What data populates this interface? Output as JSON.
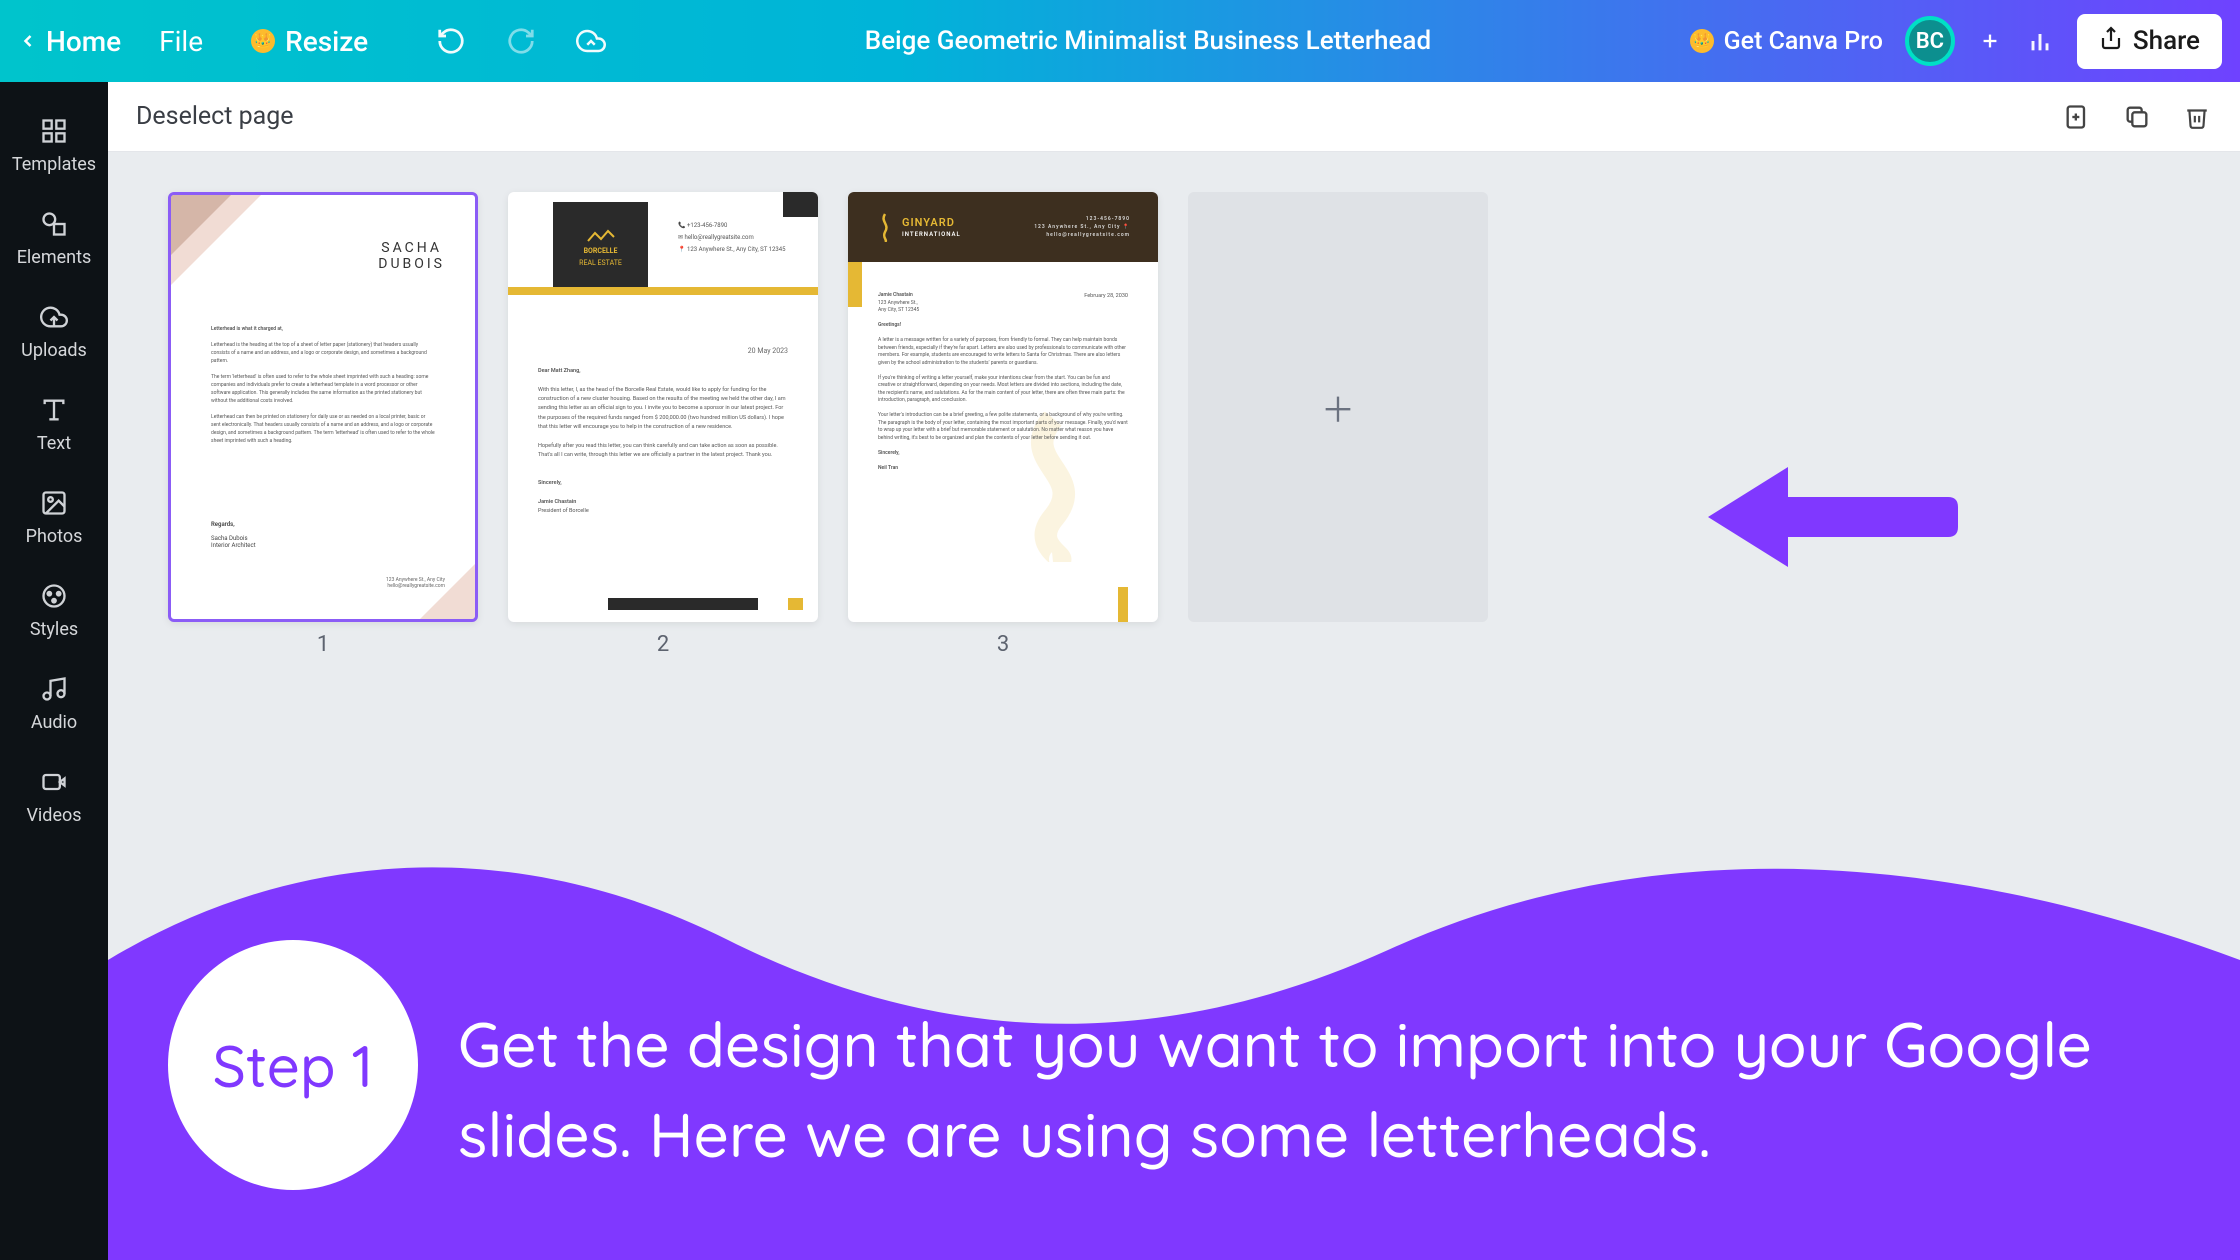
{
  "topbar": {
    "home": "Home",
    "file": "File",
    "resize": "Resize",
    "title": "Beige Geometric Minimalist Business Letterhead",
    "pro": "Get Canva Pro",
    "avatar": "BC",
    "share": "Share"
  },
  "sidebar": {
    "items": [
      {
        "label": "Templates"
      },
      {
        "label": "Elements"
      },
      {
        "label": "Uploads"
      },
      {
        "label": "Text"
      },
      {
        "label": "Photos"
      },
      {
        "label": "Styles"
      },
      {
        "label": "Audio"
      },
      {
        "label": "Videos"
      }
    ]
  },
  "subbar": {
    "deselect": "Deselect page"
  },
  "pages": {
    "p1": "1",
    "p2": "2",
    "p3": "3"
  },
  "thumb1": {
    "name1": "SACHA",
    "name2": "DUBOIS",
    "b1": "Letterhead is what it charged at,",
    "b2": "Letterhead is the heading at the top of a sheet of letter paper (stationery) that headers usually consists of a name and an address, and a logo or corporate design, and sometimes a background pattern.",
    "b3": "The term 'letterhead' is often used to refer to the whole sheet imprinted with such a heading: some companies and individuals prefer to create a letterhead template in a word processor or other software application. This generally includes the same information as the printed stationery but without the additional costs involved.",
    "b4": "Letterhead can then be printed on stationery for daily use or as needed on a local printer, basic or sent electronically. That headers usually consists of a name and an address, and a logo or corporate design, and sometimes a background pattern. The term 'letterhead' is often used to refer to the whole sheet imprinted with such a heading.",
    "sig1": "Regards,",
    "sig2": "Sacha Dubois",
    "sig3": "Interior Architect",
    "foot1": "123 Anywhere St., Any City",
    "foot2": "hello@reallygreatsite.com"
  },
  "thumb2": {
    "brand1": "BORCELLE",
    "brand2": "REAL ESTATE",
    "c1": "+123-456-7890",
    "c2": "hello@reallygreatsite.com",
    "c3": "123 Anywhere St., Any City, ST 12345",
    "date": "20 May 2023",
    "dear": "Dear Matt Zhang,",
    "b1": "With this letter, I, as the head of the Borcelle Real Estate, would like to apply for funding for the construction of a new cluster housing. Based on the results of the meeting we held the other day, I am sending this letter as an official sign to you. I invite you to become a sponsor in our latest project. For the purposes of the required funds ranged from $ 200,000.00 (two hundred million US dollars). I hope that this letter will encourage you to help in the construction of a new residence.",
    "b2": "Hopefully after you read this letter, you can think carefully and can take action as soon as possible. That's all I can write, through this letter we are officially a partner in the latest project. Thank you.",
    "sig1": "Sincerely,",
    "sig2": "Jamie Chastain",
    "sig3": "President of Borcelle"
  },
  "thumb3": {
    "brand": "GINYARD",
    "sub": "INTERNATIONAL",
    "c1": "123-456-7890",
    "c2": "123 Anywhere St., Any City",
    "c3": "hello@reallygreatsite.com",
    "addr1": "Jamie Chastain",
    "addr2": "123 Anywhere St.,",
    "addr3": "Any City, ST 12345",
    "date": "February 28, 2030",
    "greet": "Greetings!",
    "b1": "A letter is a message written for a variety of purposes, from friendly to formal. They can help maintain bonds between friends, especially if they're far apart. Letters are also used by professionals to communicate with other members. For example, students are encouraged to write letters to Santa for Christmas. There are also letters given by the school administration to the students' parents or guardians.",
    "b2": "If you're thinking of writing a letter yourself, make your intentions clear from the start. You can be fun and creative or straightforward, depending on your needs. Most letters are divided into sections, including the date, the recipient's name, and salutations. As for the main content of your letter, there are often three main parts: the introduction, paragraph, and conclusion.",
    "b3": "Your letter's introduction can be a brief greeting, a few polite statements, or a background of why you're writing. The paragraph is the body of your letter, containing the most important parts of your message. Finally, you'd want to wrap up your letter with a brief but memorable statement or salutation. No matter what reason you have behind writing, it's best to be organized and plan the contents of your letter before sending it out.",
    "sig1": "Sincerely,",
    "sig2": "Neil Tran"
  },
  "overlay": {
    "step": "Step 1",
    "text": "Get the design that you want to import into your Google slides. Here we are using some letterheads."
  }
}
